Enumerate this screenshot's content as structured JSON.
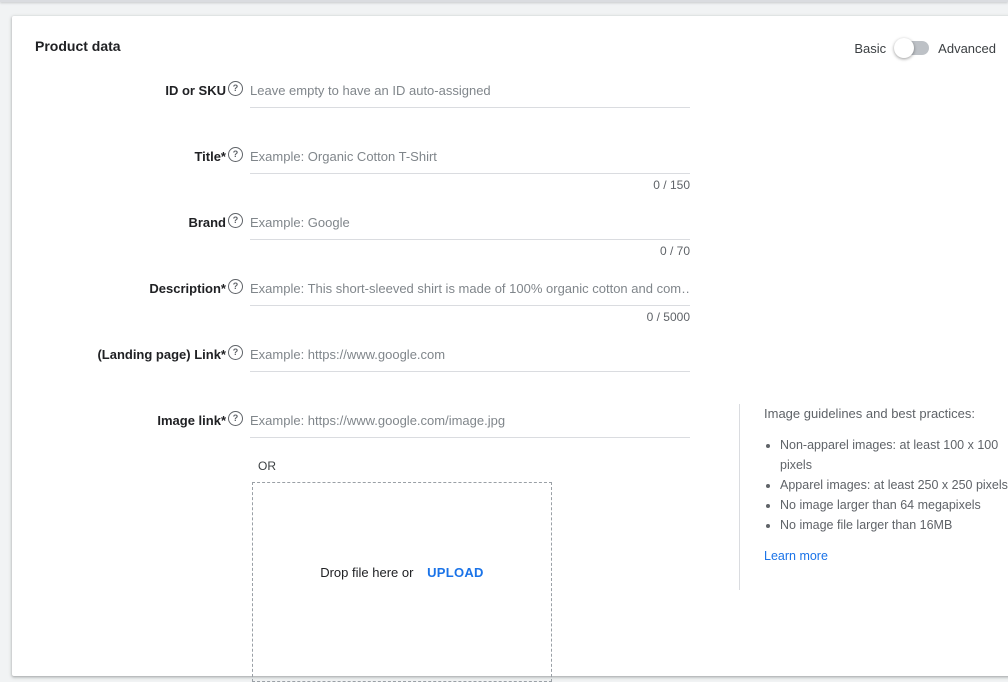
{
  "card": {
    "title": "Product data"
  },
  "mode": {
    "basic_label": "Basic",
    "advanced_label": "Advanced"
  },
  "fields": {
    "id_sku": {
      "label": "ID or SKU",
      "placeholder": "Leave empty to have an ID auto-assigned",
      "value": ""
    },
    "title": {
      "label": "Title*",
      "placeholder": "Example: Organic Cotton T-Shirt",
      "value": "",
      "counter": "0 / 150"
    },
    "brand": {
      "label": "Brand",
      "placeholder": "Example: Google",
      "value": "",
      "counter": "0 / 70"
    },
    "description": {
      "label": "Description*",
      "placeholder": "Example: This short-sleeved shirt is made of 100% organic cotton and com…",
      "value": "",
      "counter": "0 / 5000"
    },
    "landing_link": {
      "label": "(Landing page) Link*",
      "placeholder": "Example: https://www.google.com",
      "value": ""
    },
    "image_link": {
      "label": "Image link*",
      "placeholder": "Example: https://www.google.com/image.jpg",
      "value": ""
    }
  },
  "help_glyph": "?",
  "upload": {
    "or_text": "OR",
    "drop_text": "Drop file here or",
    "button_label": "UPLOAD"
  },
  "guidelines": {
    "title": "Image guidelines and best practices:",
    "items": [
      "Non-apparel images: at least 100 x 100 pixels",
      "Apparel images: at least 250 x 250 pixels",
      "No image larger than 64 megapixels",
      "No image file larger than 16MB"
    ],
    "learn_more": "Learn more"
  },
  "colors": {
    "accent": "#1a73e8",
    "text": "#202124",
    "muted": "#5f6368",
    "divider": "#dadce0"
  }
}
